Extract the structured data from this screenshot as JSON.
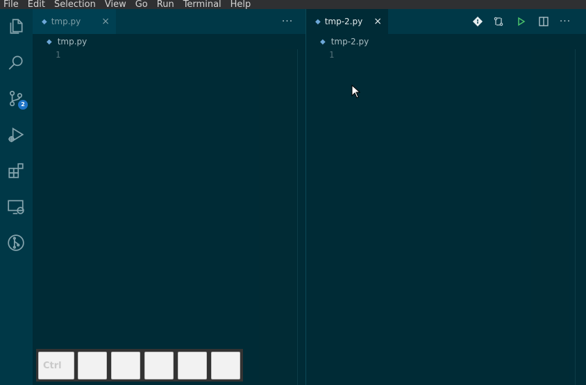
{
  "menu": [
    "File",
    "Edit",
    "Selection",
    "View",
    "Go",
    "Run",
    "Terminal",
    "Help"
  ],
  "activity_bar": {
    "items": [
      {
        "name": "explorer",
        "icon": "files-icon"
      },
      {
        "name": "search",
        "icon": "search-icon"
      },
      {
        "name": "source-control",
        "icon": "source-control-icon",
        "badge": "2"
      },
      {
        "name": "run-debug",
        "icon": "run-debug-icon"
      },
      {
        "name": "extensions",
        "icon": "extensions-icon"
      },
      {
        "name": "remote-explorer",
        "icon": "remote-explorer-icon"
      },
      {
        "name": "git-graph",
        "icon": "git-graph-icon"
      }
    ]
  },
  "editor_left": {
    "tab": {
      "label": "tmp.py",
      "close": "×"
    },
    "more": "···",
    "breadcrumb": "tmp.py",
    "line_number": "1"
  },
  "editor_right": {
    "tab": {
      "label": "tmp-2.py",
      "close": "×"
    },
    "actions": [
      "git-icon",
      "compare-icon",
      "run-icon",
      "split-editor-icon"
    ],
    "more": "···",
    "breadcrumb": "tmp-2.py",
    "line_number": "1"
  },
  "key_overlay": {
    "keys": [
      "Ctrl",
      "",
      "",
      "",
      "",
      ""
    ]
  },
  "colors": {
    "background": "#002b36",
    "activity_bar": "#003847",
    "badge": "#1e74c6",
    "run_icon": "#4ac26b"
  }
}
